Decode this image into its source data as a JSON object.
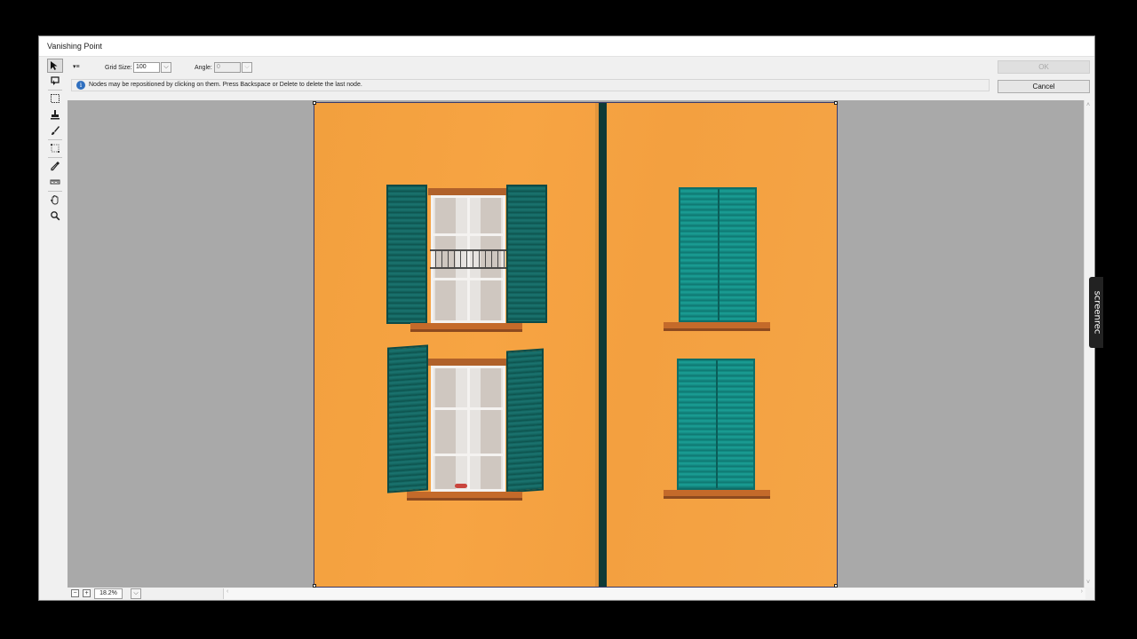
{
  "window": {
    "title": "Vanishing Point"
  },
  "toolbar": {
    "grid_size_label": "Grid Size:",
    "grid_size_value": "100",
    "angle_label": "Angle:",
    "angle_value": "0"
  },
  "info": {
    "message": "Nodes may be repositioned by clicking on them.  Press Backspace or Delete to delete the last node."
  },
  "buttons": {
    "ok": "OK",
    "cancel": "Cancel"
  },
  "status": {
    "zoom": "18.2%"
  },
  "tools": [
    "edit-plane-tool",
    "create-plane-tool",
    "marquee-tool",
    "stamp-tool",
    "brush-tool",
    "transform-tool",
    "eyedropper-tool",
    "measure-tool",
    "hand-tool",
    "zoom-tool"
  ],
  "watermark": {
    "text": "screenrec"
  },
  "colors": {
    "facade": "#f5a443",
    "shutter": "#147a73",
    "canvas_bg": "#a9a9a9"
  }
}
